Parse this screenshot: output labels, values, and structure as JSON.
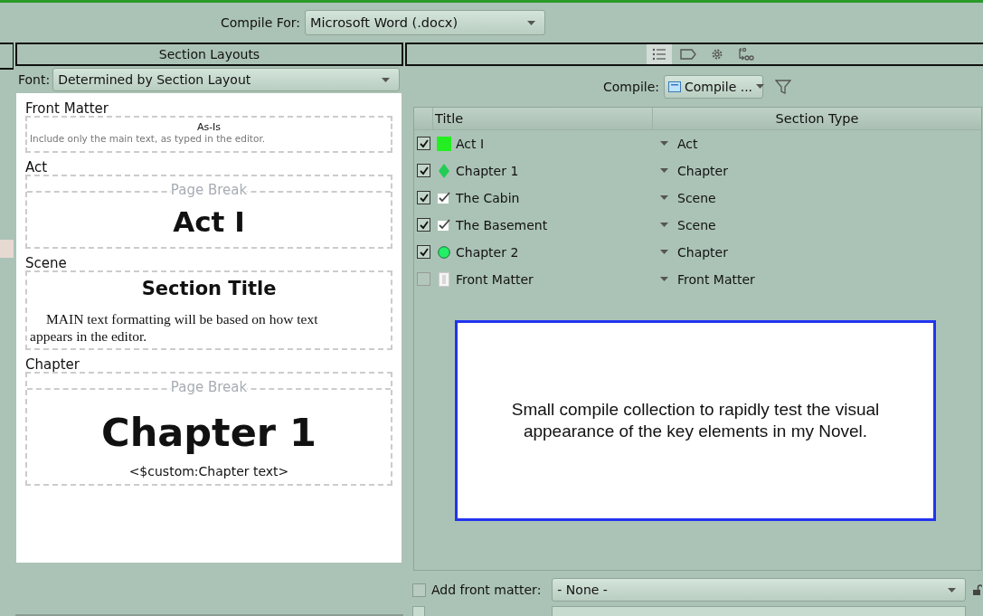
{
  "compile_for": {
    "label": "Compile For:",
    "value": "Microsoft Word (.docx)"
  },
  "section_layouts": {
    "title": "Section Layouts",
    "font_label": "Font:",
    "font_value": "Determined by Section Layout",
    "layouts": [
      {
        "kind": "asis",
        "name": "Front Matter",
        "title": "As-Is",
        "text": "Include only the main text, as typed in the editor."
      },
      {
        "kind": "pagebreak",
        "name": "Act",
        "page_break": "Page Break",
        "title": "Act I"
      },
      {
        "kind": "text",
        "name": "Scene",
        "title": "Section Title",
        "text": "MAIN text formatting will be based on how text appears in the editor."
      },
      {
        "kind": "pagebreak",
        "name": "Chapter",
        "page_break": "Page Break",
        "title": "Chapter 1",
        "text": "<$custom:Chapter text>"
      }
    ]
  },
  "view_tabs": [
    {
      "kind": "list",
      "selected": true
    },
    {
      "kind": "tag",
      "selected": false
    },
    {
      "kind": "gear",
      "selected": false
    },
    {
      "kind": "replace",
      "selected": false
    }
  ],
  "compile_collection": {
    "label": "Compile:",
    "value": "Compile ..."
  },
  "table": {
    "columns": [
      "Title",
      "Section Type"
    ],
    "rows": [
      {
        "checked": true,
        "kind": "square",
        "color": "#22ee22",
        "title": "Act I",
        "section_type": "Act"
      },
      {
        "checked": true,
        "kind": "diamond",
        "color": "#22cc55",
        "title": "Chapter 1",
        "section_type": "Chapter"
      },
      {
        "checked": true,
        "kind": "check",
        "title": "The Cabin",
        "section_type": "Scene"
      },
      {
        "checked": true,
        "kind": "check",
        "title": "The Basement",
        "section_type": "Scene"
      },
      {
        "checked": true,
        "kind": "circle",
        "color": "#22ee66",
        "title": "Chapter 2",
        "section_type": "Chapter"
      },
      {
        "checked": false,
        "kind": "page",
        "title": "Front Matter",
        "section_type": "Front Matter"
      }
    ]
  },
  "description": "Small compile collection to rapidly test the visual appearance of the key elements in my Novel.",
  "front_matter": {
    "checked": false,
    "label": "Add front matter:",
    "value": "- None -",
    "locked": false
  },
  "next_option": {
    "checked": false
  }
}
